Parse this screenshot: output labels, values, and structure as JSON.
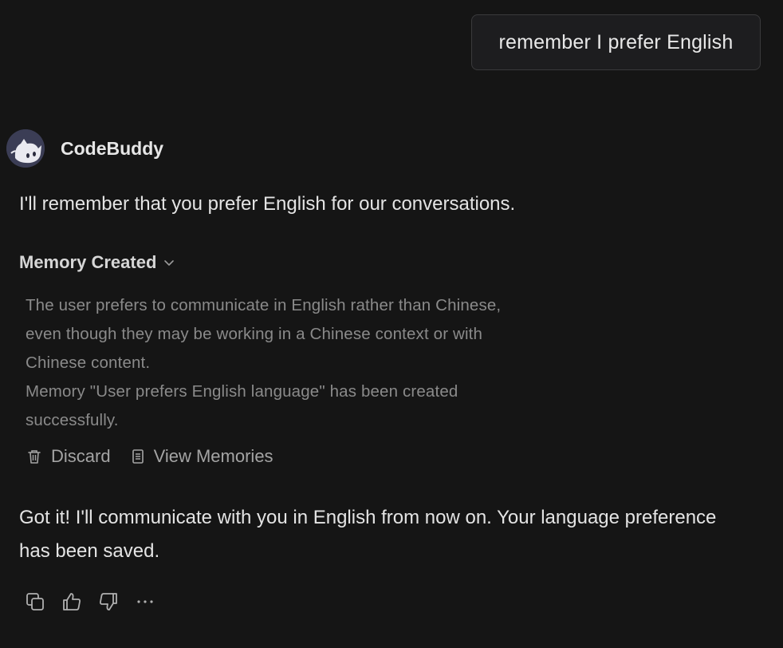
{
  "user_message": {
    "text": "remember I prefer English"
  },
  "assistant": {
    "name": "CodeBuddy",
    "avatar_icon": "robot-cat-avatar"
  },
  "messages": {
    "first": "I'll remember that you prefer English for our conversations.",
    "final": "Got it! I'll communicate with you in English from now on. Your language preference has been saved."
  },
  "memory": {
    "title": "Memory Created",
    "lines": [
      "The user prefers to communicate in English rather than Chinese,",
      "even though they may be working in a Chinese context or with",
      "Chinese content.",
      "Memory \"User prefers English language\" has been created",
      "successfully."
    ],
    "actions": {
      "discard_label": "Discard",
      "view_label": "View Memories"
    }
  },
  "feedback": {
    "icons": [
      "copy-icon",
      "thumbs-up-icon",
      "thumbs-down-icon",
      "more-icon"
    ]
  },
  "colors": {
    "background": "#151515",
    "bubble": "#1d1d1f",
    "bubble_border": "#3a3a3c",
    "text_primary": "#e4e4e4",
    "text_muted": "#8a8a8a",
    "avatar_bg": "#3b3d55"
  }
}
